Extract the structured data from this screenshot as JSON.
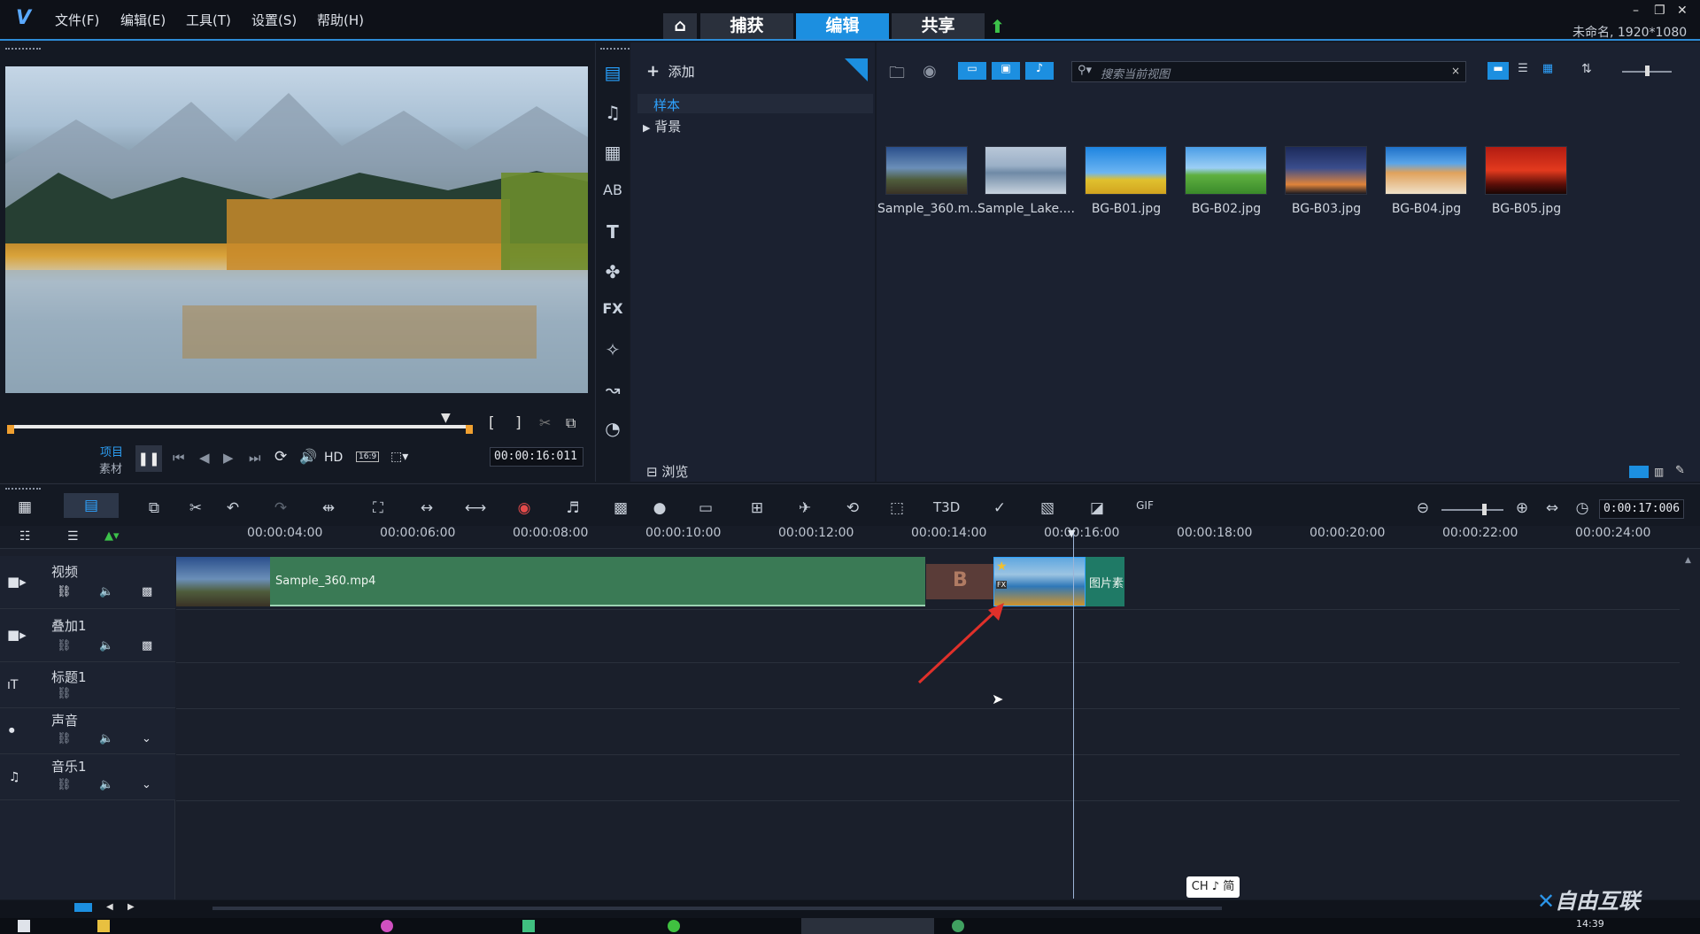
{
  "menu": {
    "file": "文件(F)",
    "edit": "编辑(E)",
    "tools": "工具(T)",
    "settings": "设置(S)",
    "help": "帮助(H)"
  },
  "modes": {
    "capture": "捕获",
    "edit": "编辑",
    "share": "共享"
  },
  "window": {
    "project_info": "未命名, 1920*1080"
  },
  "player": {
    "project_label": "项目",
    "clip_label": "素材",
    "hd_label": "HD",
    "aspect": "16:9",
    "timecode": "00:00:16:011"
  },
  "library": {
    "add_label": "添加",
    "tree": {
      "sample": "样本",
      "background": "背景"
    },
    "browse_label": "浏览",
    "search_placeholder": "搜索当前视图",
    "thumbnails": [
      {
        "label": "Sample_360.m..."
      },
      {
        "label": "Sample_Lake...."
      },
      {
        "label": "BG-B01.jpg"
      },
      {
        "label": "BG-B02.jpg"
      },
      {
        "label": "BG-B03.jpg"
      },
      {
        "label": "BG-B04.jpg"
      },
      {
        "label": "BG-B05.jpg"
      }
    ]
  },
  "timeline": {
    "duration": "0:00:17:006",
    "ruler": [
      "00:00:04:00",
      "00:00:06:00",
      "00:00:08:00",
      "00:00:10:00",
      "00:00:12:00",
      "00:00:14:00",
      "00:00:16:00",
      "00:00:18:00",
      "00:00:20:00",
      "00:00:22:00",
      "00:00:24:00"
    ],
    "tracks": [
      {
        "name": "视频"
      },
      {
        "name": "叠加1"
      },
      {
        "name": "标题1"
      },
      {
        "name": "声音"
      },
      {
        "name": "音乐1"
      }
    ],
    "clip_video_label": "Sample_360.mp4",
    "clip_image_label": "图片素"
  },
  "ime": {
    "label": "CH ♪ 简"
  },
  "taskbar": {
    "time": "14:39"
  },
  "watermark": {
    "text": "自由互联"
  },
  "colors": {
    "accent": "#1c8fe0",
    "video_clip": "#3a7a55",
    "image_clip": "#1f7a66",
    "arrow": "#e0302a"
  }
}
